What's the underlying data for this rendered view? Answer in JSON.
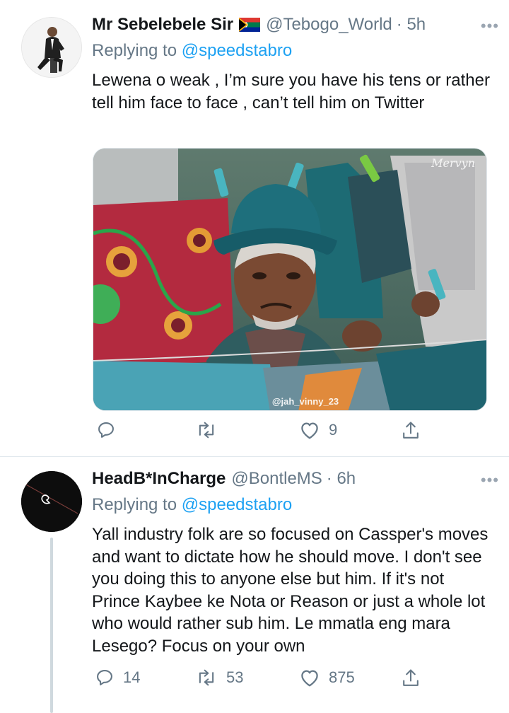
{
  "tweets": [
    {
      "author_name": "Mr Sebelebele Sir",
      "author_handle": "@Tebogo_World",
      "time": "· 5h",
      "replying_prefix": "Replying to",
      "replying_to": "@speedstabro",
      "text": "Lewena o weak , I’m sure you have his tens or rather tell him face to face , can’t tell him on Twitter",
      "media": {
        "watermark_top": "Mervyn",
        "watermark_bottom": "@jah_vinny_23"
      },
      "actions": {
        "replies": "",
        "retweets": "",
        "likes": "9"
      }
    },
    {
      "author_name": "HeadB*InCharge",
      "author_handle": "@BontleMS",
      "time": "· 6h",
      "replying_prefix": "Replying to",
      "replying_to": "@speedstabro",
      "text": "Yall industry folk are so focused on Cassper's moves and want to dictate how he should move. I don't see you doing this to anyone else but him. If it's not Prince Kaybee ke Nota or Reason or just a whole lot who would rather sub him. Le mmatla eng mara Lesego? Focus on your own",
      "actions": {
        "replies": "14",
        "retweets": "53",
        "likes": "875"
      }
    }
  ],
  "more_label": "•••",
  "colors": {
    "accent": "#1da1f2",
    "secondary_text": "#657786",
    "border": "#e1e8ed"
  },
  "icons": [
    "reply-icon",
    "retweet-icon",
    "like-icon",
    "share-icon",
    "more-icon",
    "south-africa-flag-icon"
  ]
}
